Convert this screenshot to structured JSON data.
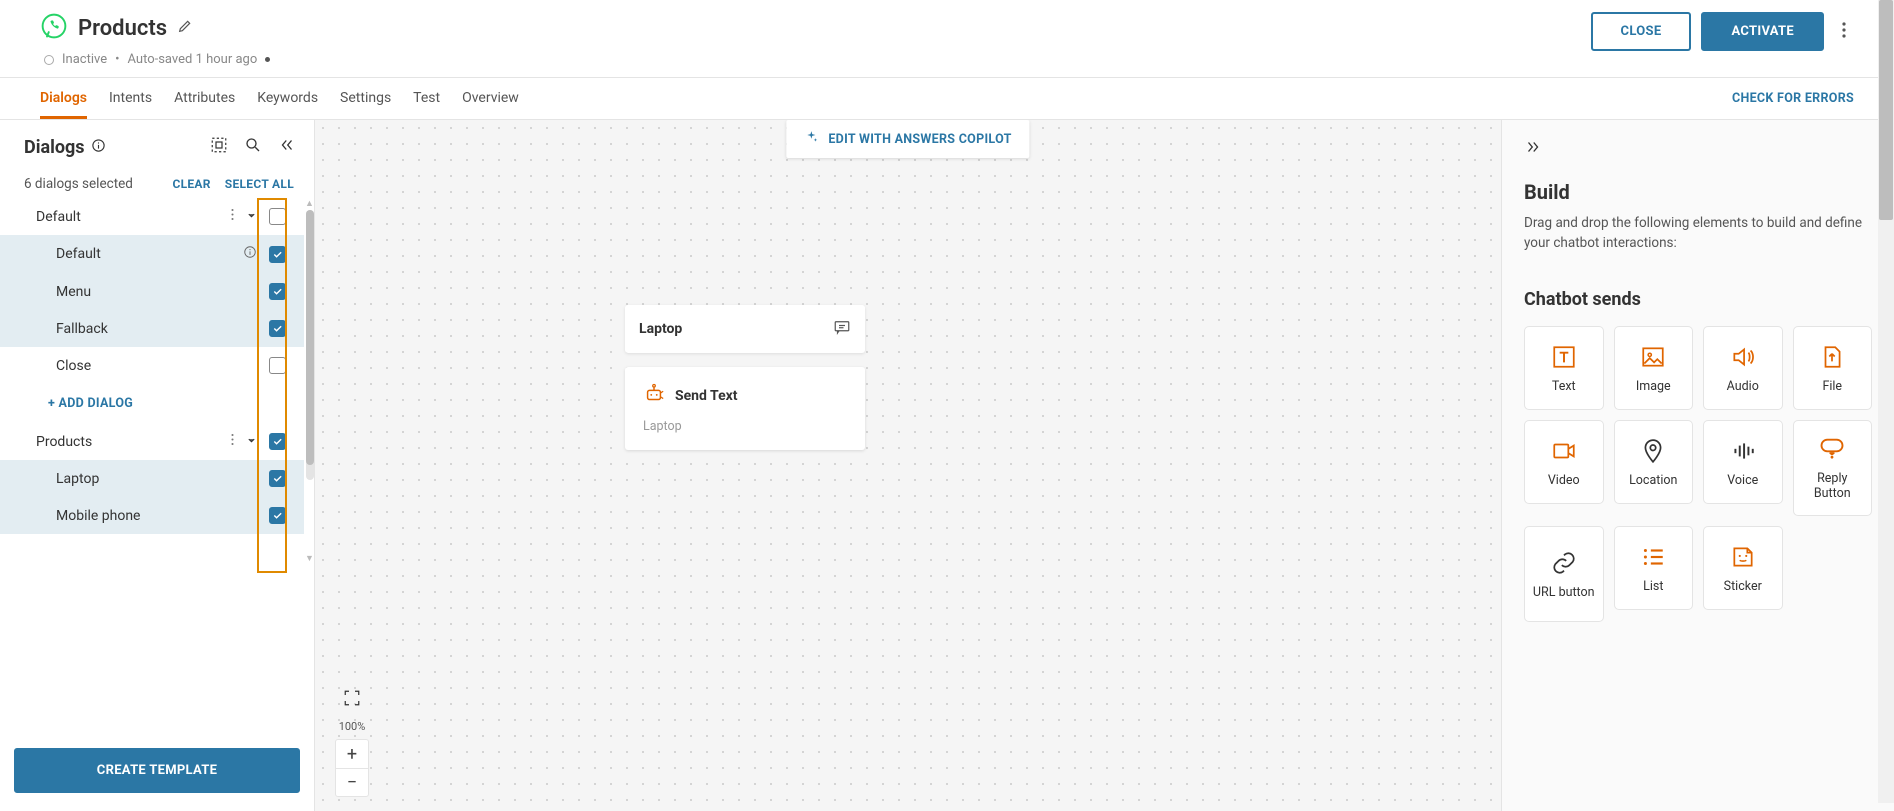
{
  "header": {
    "title": "Products",
    "status": "Inactive",
    "autosaved": "Auto-saved 1 hour ago",
    "close": "CLOSE",
    "activate": "ACTIVATE"
  },
  "tabs": {
    "items": [
      "Dialogs",
      "Intents",
      "Attributes",
      "Keywords",
      "Settings",
      "Test",
      "Overview"
    ],
    "active_index": 0,
    "check_errors": "CHECK FOR ERRORS"
  },
  "sidebar": {
    "title": "Dialogs",
    "selected_text": "6 dialogs selected",
    "clear": "CLEAR",
    "select_all": "SELECT ALL",
    "add_dialog": "+ ADD DIALOG",
    "create_template": "CREATE TEMPLATE",
    "groups": [
      {
        "name": "Default",
        "checked": false,
        "show_info": false,
        "items": [
          {
            "name": "Default",
            "checked": true,
            "show_info": true
          },
          {
            "name": "Menu",
            "checked": true,
            "show_info": false
          },
          {
            "name": "Fallback",
            "checked": true,
            "show_info": false
          },
          {
            "name": "Close",
            "checked": false,
            "show_info": false
          }
        ],
        "add_dialog": true
      },
      {
        "name": "Products",
        "checked": true,
        "show_info": false,
        "items": [
          {
            "name": "Laptop",
            "checked": true,
            "show_info": false
          },
          {
            "name": "Mobile phone",
            "checked": true,
            "show_info": false
          }
        ],
        "add_dialog": false
      }
    ]
  },
  "canvas": {
    "copilot": "EDIT WITH ANSWERS COPILOT",
    "node_title": "Laptop",
    "send_text_label": "Send Text",
    "send_text_body": "Laptop",
    "zoom": "100%"
  },
  "right": {
    "title": "Build",
    "desc": "Drag and drop the following elements to build and define your chatbot interactions:",
    "section": "Chatbot sends",
    "blocks": [
      {
        "name": "Text",
        "icon": "text",
        "accent": true
      },
      {
        "name": "Image",
        "icon": "image",
        "accent": true
      },
      {
        "name": "Audio",
        "icon": "audio",
        "accent": true
      },
      {
        "name": "File",
        "icon": "file",
        "accent": true
      },
      {
        "name": "Video",
        "icon": "video",
        "accent": true
      },
      {
        "name": "Location",
        "icon": "location",
        "accent": false
      },
      {
        "name": "Voice",
        "icon": "voice",
        "accent": false
      },
      {
        "name": "Reply Button",
        "icon": "reply",
        "accent": true
      },
      {
        "name": "URL button",
        "icon": "url",
        "accent": false
      },
      {
        "name": "List",
        "icon": "list",
        "accent": true
      },
      {
        "name": "Sticker",
        "icon": "sticker",
        "accent": true
      }
    ]
  }
}
